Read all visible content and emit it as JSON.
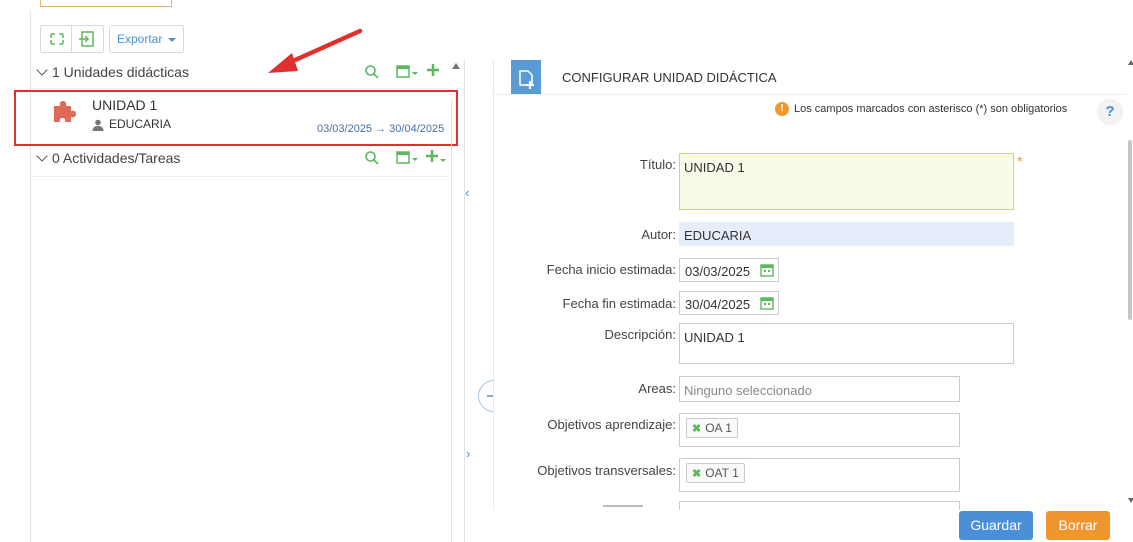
{
  "toolbar": {
    "export_label": "Exportar"
  },
  "left_panel": {
    "units_header": "1 Unidades didácticas",
    "activities_header": "0 Actividades/Tareas",
    "unit_item": {
      "title": "UNIDAD 1",
      "author": "EDUCARIA",
      "dates": "03/03/2025 → 30/04/2025"
    }
  },
  "form": {
    "header": "CONFIGURAR UNIDAD DIDÁCTICA",
    "required_note": "Los campos marcados con asterisco (*) son obligatorios",
    "help": "?",
    "titulo_label": "Título:",
    "titulo_value": "UNIDAD 1",
    "required_mark": "*",
    "autor_label": "Autor:",
    "autor_value": "EDUCARIA",
    "fecha_inicio_label": "Fecha inicio estimada:",
    "fecha_inicio_value": "03/03/2025",
    "fecha_fin_label": "Fecha fin estimada:",
    "fecha_fin_value": "30/04/2025",
    "descripcion_label": "Descripción:",
    "descripcion_value": "UNIDAD 1",
    "areas_label": "Areas:",
    "areas_placeholder": "Ninguno seleccionado",
    "objetivos_label": "Objetivos aprendizaje:",
    "objetivos_tag": "OA 1",
    "transversales_label": "Objetivos transversales:",
    "transversales_tag": "OAT 1"
  },
  "buttons": {
    "guardar": "Guardar",
    "borrar": "Borrar"
  },
  "colors": {
    "accent_blue": "#5b9bd5",
    "guardar_bg": "#4a8fd8",
    "borrar_bg": "#f0962f",
    "highlight_red": "#e0302e",
    "green_icon": "#5cb85c",
    "autor_bg": "#e7eefb",
    "titulo_bg": "#f7fbe8"
  }
}
